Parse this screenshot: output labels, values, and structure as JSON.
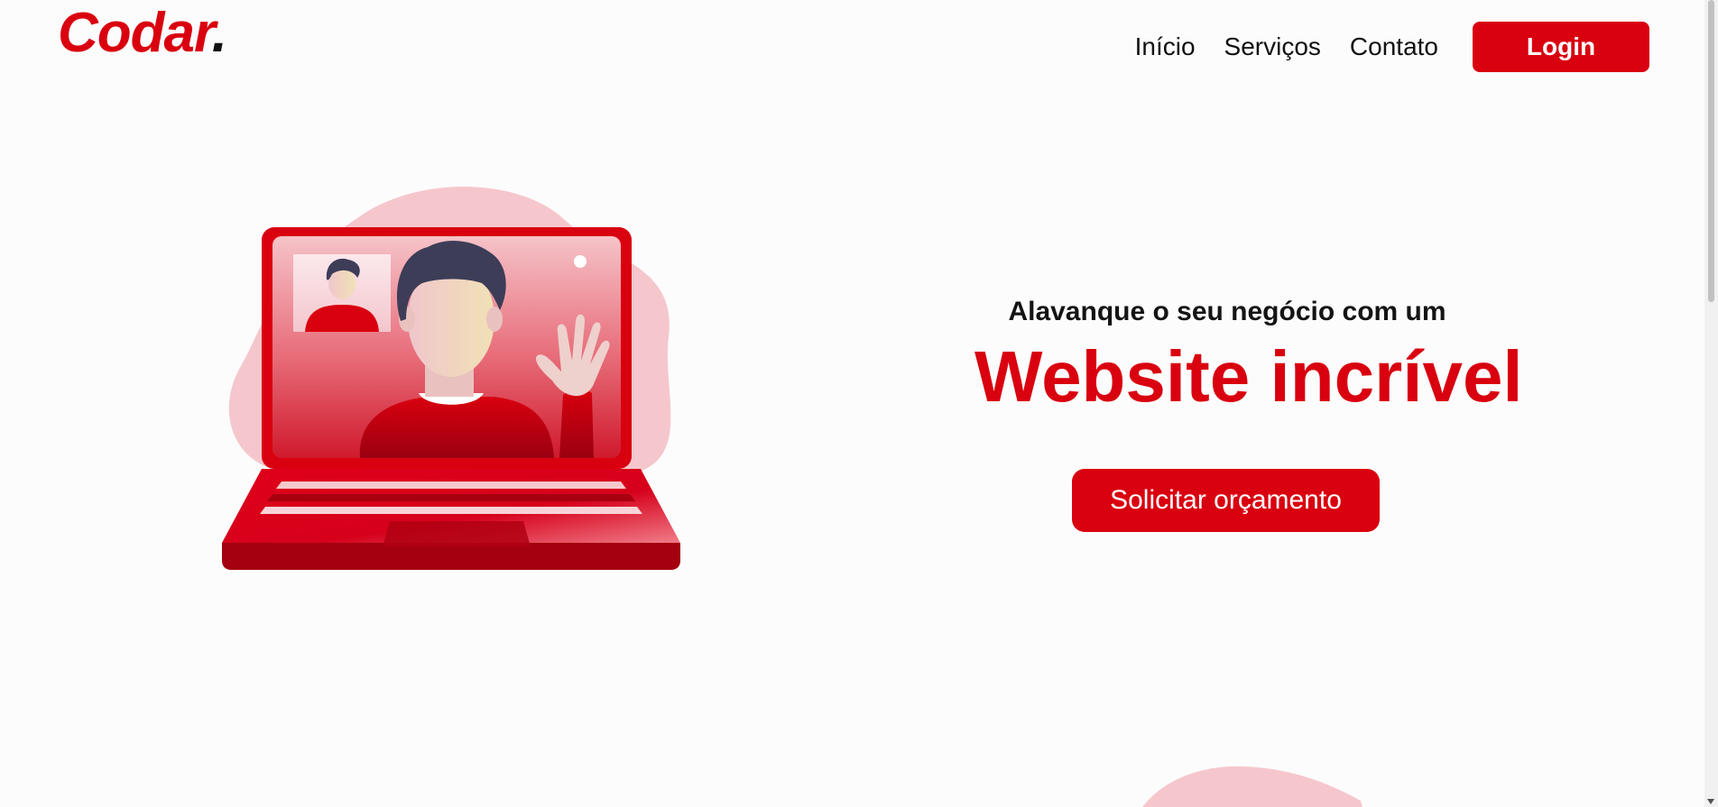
{
  "brand": {
    "logo_text": "Codar",
    "logo_dot": ".",
    "accent_color": "#d9000f"
  },
  "nav": {
    "items": [
      {
        "label": "Início"
      },
      {
        "label": "Serviços"
      },
      {
        "label": "Contato"
      }
    ],
    "login_label": "Login"
  },
  "hero": {
    "subtitle": "Alavanque o seu negócio com um",
    "title": "Website incrível",
    "cta_label": "Solicitar orçamento",
    "illustration": "laptop-video-call-illustration"
  }
}
